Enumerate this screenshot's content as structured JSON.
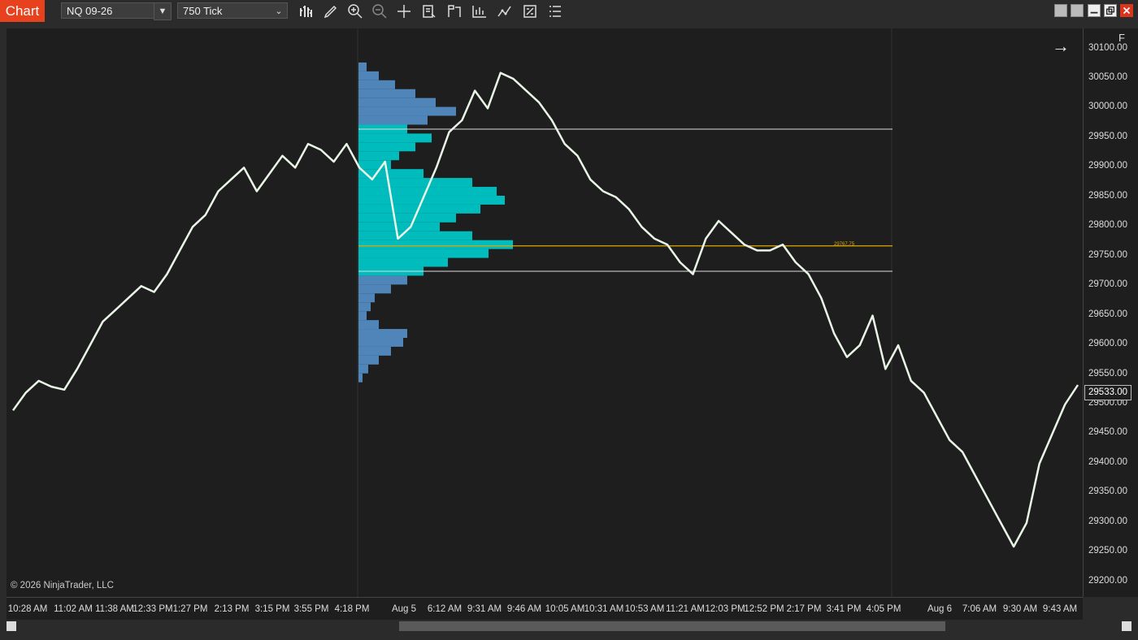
{
  "window": {
    "tab_label": "Chart",
    "instrument": "NQ 09-26",
    "bar_type": "750 Tick"
  },
  "toolbar_icons": [
    "bar-type-icon",
    "draw-pencil-icon",
    "zoom-in-icon",
    "zoom-out-icon",
    "crosshair-icon",
    "data-box-icon",
    "indicators-icon",
    "strategies-icon",
    "chart-trader-icon",
    "properties-icon",
    "menu-icon"
  ],
  "copyright": "© 2026 NinjaTrader, LLC",
  "f_button": "F",
  "last_price": "29533.00",
  "poc_label": "29767.75",
  "colors": {
    "price_line": "#e9f5e6",
    "value_area": "#00bcbc",
    "profile_outer": "#4f85b8",
    "poc_line": "#e0a800",
    "va_line": "#dddddd",
    "tab_accent": "#e8411d"
  },
  "chart_data": {
    "type": "line",
    "title": "",
    "ylim": [
      29175,
      30135
    ],
    "y_ticks": [
      "30100.00",
      "30050.00",
      "30000.00",
      "29950.00",
      "29900.00",
      "29850.00",
      "29800.00",
      "29750.00",
      "29700.00",
      "29650.00",
      "29600.00",
      "29550.00",
      "29500.00",
      "29450.00",
      "29400.00",
      "29350.00",
      "29300.00",
      "29250.00",
      "29200.00"
    ],
    "x_ticks": [
      "10:28 AM",
      "11:02 AM",
      "11:38 AM",
      "12:33 PM",
      "1:27 PM",
      "2:13 PM",
      "3:15 PM",
      "3:55 PM",
      "4:18 PM",
      "Aug 5",
      "6:12 AM",
      "9:31 AM",
      "9:46 AM",
      "10:05 AM",
      "10:31 AM",
      "10:53 AM",
      "11:21 AM",
      "12:03 PM",
      "12:52 PM",
      "2:17 PM",
      "3:41 PM",
      "4:05 PM",
      "Aug 6",
      "7:06 AM",
      "9:30 AM",
      "9:43 AM"
    ],
    "price_series": [
      29490,
      29520,
      29540,
      29530,
      29525,
      29560,
      29600,
      29640,
      29660,
      29680,
      29700,
      29690,
      29720,
      29760,
      29800,
      29820,
      29860,
      29880,
      29900,
      29860,
      29890,
      29920,
      29900,
      29940,
      29930,
      29910,
      29940,
      29900,
      29880,
      29910,
      29780,
      29800,
      29850,
      29900,
      29960,
      29980,
      30030,
      30000,
      30060,
      30050,
      30030,
      30010,
      29980,
      29940,
      29920,
      29880,
      29860,
      29850,
      29830,
      29800,
      29780,
      29770,
      29740,
      29720,
      29780,
      29810,
      29790,
      29770,
      29760,
      29760,
      29770,
      29740,
      29720,
      29680,
      29620,
      29580,
      29600,
      29650,
      29560,
      29600,
      29540,
      29520,
      29480,
      29440,
      29420,
      29380,
      29340,
      29300,
      29260,
      29300,
      29400,
      29450,
      29500,
      29533
    ],
    "volume_profile": {
      "prices": [
        30070,
        30055,
        30040,
        30025,
        30010,
        29995,
        29980,
        29965,
        29950,
        29935,
        29920,
        29905,
        29890,
        29875,
        29860,
        29845,
        29830,
        29815,
        29800,
        29785,
        29770,
        29755,
        29740,
        29725,
        29710,
        29695,
        29680,
        29665,
        29650,
        29635,
        29620,
        29605,
        29590,
        29575,
        29560,
        29545
      ],
      "volumes": [
        10,
        25,
        45,
        70,
        95,
        120,
        85,
        60,
        90,
        70,
        50,
        40,
        80,
        140,
        170,
        180,
        150,
        120,
        100,
        140,
        190,
        160,
        110,
        80,
        60,
        40,
        20,
        15,
        10,
        25,
        60,
        55,
        40,
        25,
        12,
        5
      ],
      "poc": 29767.75,
      "value_area_high": 29965,
      "value_area_low": 29725
    }
  }
}
